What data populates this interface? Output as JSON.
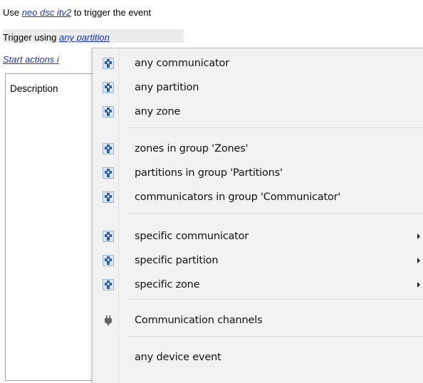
{
  "top": {
    "line1_prefix": "Use ",
    "line1_link": "neo dsc itv2",
    "line1_suffix": " to trigger the event",
    "line2_prefix": "Trigger using ",
    "line2_link": "any partition",
    "line3_link": "Start actions i"
  },
  "list": {
    "header": "Description"
  },
  "menu": {
    "items": [
      {
        "label": "any communicator",
        "icon": "puzzle-icon"
      },
      {
        "label": "any partition",
        "icon": "puzzle-icon"
      },
      {
        "label": "any zone",
        "icon": "puzzle-icon"
      },
      {
        "label": "zones in group 'Zones'",
        "icon": "puzzle-icon"
      },
      {
        "label": "partitions in group 'Partitions'",
        "icon": "puzzle-icon"
      },
      {
        "label": "communicators in group 'Communicator'",
        "icon": "puzzle-icon"
      },
      {
        "label": "specific communicator",
        "icon": "puzzle-icon",
        "submenu": true
      },
      {
        "label": "specific partition",
        "icon": "puzzle-icon",
        "submenu": true
      },
      {
        "label": "specific zone",
        "icon": "puzzle-icon",
        "submenu": true
      },
      {
        "label": "Communication channels",
        "icon": "plug-icon"
      },
      {
        "label": "any device event"
      }
    ]
  },
  "colors": {
    "link": "#1a35c8",
    "menu_bg": "#f2f2f2",
    "icon_blue": "#2f5f9c"
  }
}
